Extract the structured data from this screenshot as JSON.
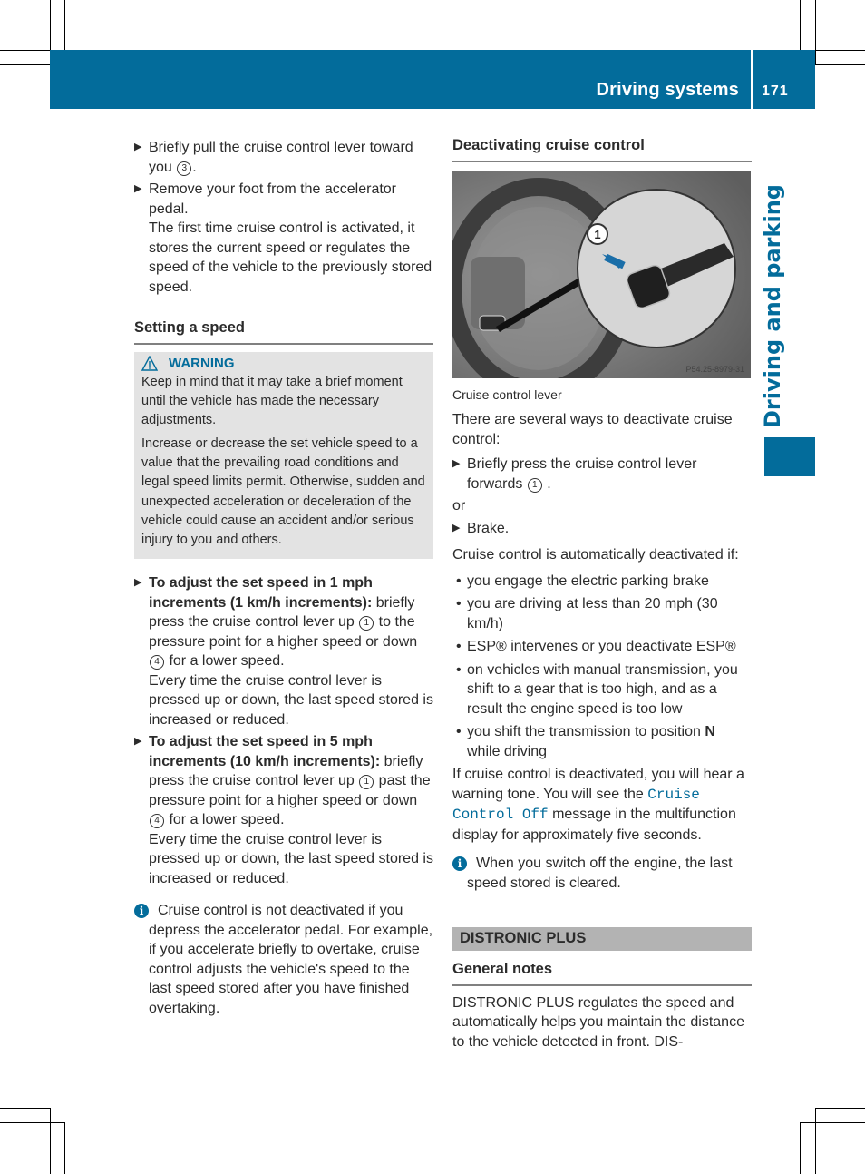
{
  "header": {
    "section_title": "Driving systems",
    "page_number": "171",
    "side_tab": "Driving and parking",
    "accent_color": "#036c9b"
  },
  "left_column": {
    "steps_intro": [
      {
        "text_before": "Briefly pull the cruise control lever toward you ",
        "ref": "3",
        "text_after": "."
      },
      {
        "text": "Remove your foot from the accelerator pedal.",
        "note": "The first time cruise control is activated, it stores the current speed or regulates the speed of the vehicle to the previously stored speed."
      }
    ],
    "setting_heading": "Setting a speed",
    "warning": {
      "title": "WARNING",
      "icon": "warning-triangle-icon",
      "paragraphs": [
        "Keep in mind that it may take a brief moment until the vehicle has made the necessary adjustments.",
        "Increase or decrease the set vehicle speed to a value that the prevailing road conditions and legal speed limits permit. Otherwise, sudden and unexpected acceleration or deceleration of the vehicle could cause an accident and/or serious injury to you and others."
      ]
    },
    "adjust_steps": [
      {
        "bold": "To adjust the set speed in 1 mph increments (1 km/h increments):",
        "t1": " briefly press the cruise control lever up ",
        "ref1": "1",
        "t2": " to the pressure point for a higher speed or down ",
        "ref2": "4",
        "t3": " for a lower speed.",
        "note": "Every time the cruise control lever is pressed up or down, the last speed stored is increased or reduced."
      },
      {
        "bold": "To adjust the set speed in 5 mph increments (10 km/h increments):",
        "t1": " briefly press the cruise control lever up ",
        "ref1": "1",
        "t2": " past the pressure point for a higher speed or down ",
        "ref2": "4",
        "t3": " for a lower speed.",
        "note": "Every time the cruise control lever is pressed up or down, the last speed stored is increased or reduced."
      }
    ],
    "info_note": "Cruise control is not deactivated if you depress the accelerator pedal. For example, if you accelerate briefly to overtake, cruise control adjusts the vehicle's speed to the last speed stored after you have finished overtaking."
  },
  "right_column": {
    "deactivating_heading": "Deactivating cruise control",
    "figure": {
      "callout": "1",
      "image_code": "P54.25-8979-31",
      "caption": "Cruise control lever"
    },
    "intro": "There are several ways to deactivate cruise control:",
    "step1": {
      "text": "Briefly press the cruise control lever forwards ",
      "ref": "1",
      "after": " ."
    },
    "or": "or",
    "step2": "Brake.",
    "auto_intro": "Cruise control is automatically deactivated if:",
    "bullets": [
      "you engage the electric parking brake",
      "you are driving at less than 20 mph (30 km/h)",
      "ESP® intervenes or you deactivate ESP®",
      "on vehicles with manual transmission, you shift to a gear that is too high, and as a result the engine speed is too low"
    ],
    "bullet_last": {
      "text": "you shift the transmission to position ",
      "bold": "N",
      "after": " while driving"
    },
    "deact_para": {
      "before": "If cruise control is deactivated, you will hear a warning tone. You will see the ",
      "display": "Cruise Control Off",
      "after": " message in the multifunction display for approximately five seconds."
    },
    "info_note": "When you switch off the engine, the last speed stored is cleared.",
    "distronic_heading": "DISTRONIC PLUS",
    "general_heading": "General notes",
    "general_text": "DISTRONIC PLUS regulates the speed and automatically helps you maintain the distance to the vehicle detected in front. DIS-"
  }
}
